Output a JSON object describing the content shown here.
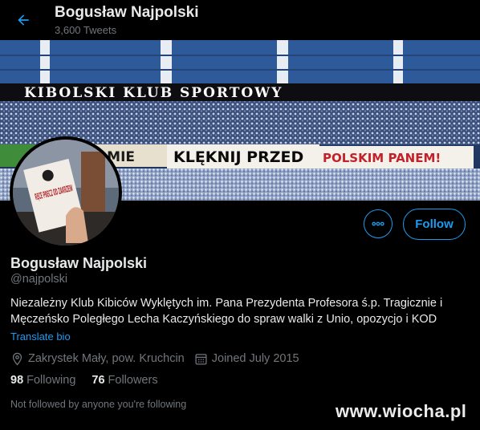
{
  "header": {
    "name": "Bogusław Najpolski",
    "tweets_count": "3,600 Tweets"
  },
  "banner": {
    "top_text": "KIBOLSKI KLUB SPORTOWY",
    "banner_text_left": "AMIE",
    "banner_text_middle": "KLĘKNIJ PRZED",
    "banner_text_right": "POLSKIM PANEM!"
  },
  "avatar": {
    "sign_text": "RĘCE PRECZ OD ZAKRZEW"
  },
  "actions": {
    "more_icon": "more-horizontal-icon",
    "follow_label": "Follow"
  },
  "profile": {
    "name": "Bogusław Najpolski",
    "handle": "@najpolski",
    "bio": "Niezależny Klub Kibiców Wyklętych im. Pana Prezydenta Profesora ś.p. Tragicznie i Męczeńsko Poległego Lecha Kaczyńskiego do spraw walki z Unio, opozycjo i KOD",
    "translate_label": "Translate bio",
    "location": "Zakrystek Mały, pow. Kruchcin",
    "joined": "Joined July 2015",
    "following_count": "98",
    "following_label": "Following",
    "followers_count": "76",
    "followers_label": "Followers",
    "not_followed_text": "Not followed by anyone you're following"
  },
  "watermark": "www.wiocha.pl",
  "colors": {
    "accent": "#1d9bf0",
    "background": "#000000",
    "secondary_text": "#71767b",
    "primary_text": "#e7e9ea"
  }
}
